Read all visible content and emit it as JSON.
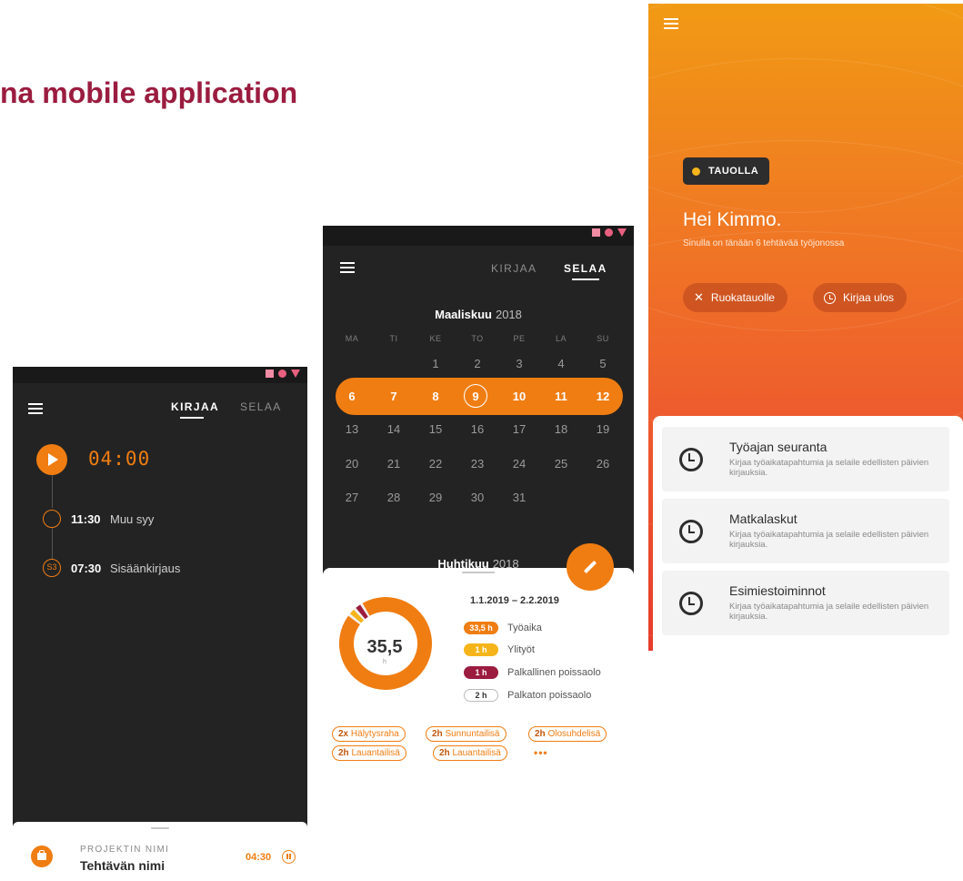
{
  "slide": {
    "title": "na mobile application"
  },
  "status_colors": {
    "square": "#f08ca4",
    "circle": "#e8607f",
    "triangle": "#e8607f"
  },
  "phone1": {
    "tabs": [
      {
        "label": "KIRJAA",
        "active": true
      },
      {
        "label": "SELAA",
        "active": false
      }
    ],
    "timer": "04:00",
    "timeline": [
      {
        "time": "11:30",
        "label": "Muu syy",
        "icon": "circle"
      },
      {
        "time": "07:30",
        "label": "Sisäänkirjaus",
        "icon": "S3"
      }
    ],
    "bottom": {
      "project_label": "PROJEKTIN NIMI",
      "task_name": "Tehtävän nimi",
      "task_time": "04:30"
    }
  },
  "phone2": {
    "tabs": [
      {
        "label": "KIRJAA",
        "active": false
      },
      {
        "label": "SELAA",
        "active": true
      }
    ],
    "calendar": {
      "month": "Maaliskuu",
      "year": "2018",
      "weekdays": [
        "MA",
        "TI",
        "KE",
        "TO",
        "PE",
        "LA",
        "SU"
      ],
      "highlighted_week": [
        "6",
        "7",
        "8",
        "9",
        "10",
        "11",
        "12"
      ],
      "today": "9",
      "next_month": "Huhtikuu",
      "next_year": "2018"
    },
    "summary": {
      "range": "1.1.2019 – 2.2.2019",
      "total": "35,5",
      "unit": "h",
      "items": [
        {
          "value": "33,5 h",
          "label": "Työaika",
          "color": "#f07d12"
        },
        {
          "value": "1 h",
          "label": "Ylityöt",
          "color": "#f5b51a"
        },
        {
          "value": "1 h",
          "label": "Palkallinen poissaolo",
          "color": "#9b1c3f"
        },
        {
          "value": "2 h",
          "label": "Palkaton poissaolo",
          "color": "outline"
        }
      ],
      "tags": [
        {
          "count": "2x",
          "label": "Hälytysraha"
        },
        {
          "count": "2h",
          "label": "Sunnuntailisä"
        },
        {
          "count": "2h",
          "label": "Olosuhdelisä"
        },
        {
          "count": "2h",
          "label": "Lauantailisä"
        },
        {
          "count": "2h",
          "label": "Lauantailisä"
        }
      ],
      "more": "•••"
    }
  },
  "phone3": {
    "status_badge": "TAUOLLA",
    "greeting": "Hei Kimmo.",
    "subtitle": "Sinulla on tänään 6 tehtävää työjonossa",
    "actions": [
      {
        "label": "Ruokatauolle",
        "icon": "cutlery-icon"
      },
      {
        "label": "Kirjaa ulos",
        "icon": "clock-icon"
      }
    ],
    "cards": [
      {
        "title": "Työajan seuranta",
        "desc": "Kirjaa työaikatapahtumia ja selaile edellisten päivien kirjauksia."
      },
      {
        "title": "Matkalaskut",
        "desc": "Kirjaa työaikatapahtumia ja selaile edellisten päivien kirjauksia."
      },
      {
        "title": "Esimiestoiminnot",
        "desc": "Kirjaa työaikatapahtumia ja selaile edellisten päivien kirjauksia."
      }
    ]
  }
}
